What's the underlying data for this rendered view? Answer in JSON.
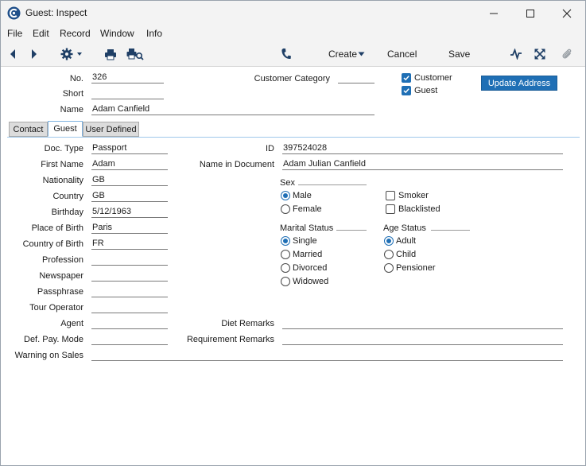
{
  "window": {
    "title": "Guest: Inspect"
  },
  "menu": {
    "items": [
      "File",
      "Edit",
      "Record",
      "Window",
      "Info"
    ]
  },
  "toolbar": {
    "create": "Create",
    "cancel": "Cancel",
    "save": "Save"
  },
  "header": {
    "no_label": "No.",
    "no_value": "326",
    "short_label": "Short",
    "short_value": "",
    "name_label": "Name",
    "name_value": "Adam Canfield",
    "customer_category_label": "Customer Category",
    "customer_category_value": "",
    "customer_label": "Customer",
    "customer_checked": true,
    "guest_label": "Guest",
    "guest_checked": true,
    "update_address": "Update Address"
  },
  "tabs": [
    "Contact",
    "Guest",
    "User Defined"
  ],
  "active_tab": "Guest",
  "guest": {
    "doc_type_label": "Doc. Type",
    "doc_type_value": "Passport",
    "first_name_label": "First Name",
    "first_name_value": "Adam",
    "nationality_label": "Nationality",
    "nationality_value": "GB",
    "country_label": "Country",
    "country_value": "GB",
    "birthday_label": "Birthday",
    "birthday_value": "5/12/1963",
    "place_of_birth_label": "Place of Birth",
    "place_of_birth_value": "Paris",
    "country_of_birth_label": "Country of Birth",
    "country_of_birth_value": "FR",
    "profession_label": "Profession",
    "profession_value": "",
    "newspaper_label": "Newspaper",
    "newspaper_value": "",
    "passphrase_label": "Passphrase",
    "passphrase_value": "",
    "tour_operator_label": "Tour Operator",
    "tour_operator_value": "",
    "agent_label": "Agent",
    "agent_value": "",
    "def_pay_mode_label": "Def. Pay. Mode",
    "def_pay_mode_value": "",
    "warning_on_sales_label": "Warning on Sales",
    "warning_on_sales_value": "",
    "id_label": "ID",
    "id_value": "397524028",
    "name_in_document_label": "Name in Document",
    "name_in_document_value": "Adam Julian Canfield",
    "diet_remarks_label": "Diet Remarks",
    "diet_remarks_value": "",
    "requirement_remarks_label": "Requirement Remarks",
    "requirement_remarks_value": "",
    "sex": {
      "title": "Sex",
      "options": [
        "Male",
        "Female"
      ],
      "selected": "Male"
    },
    "smoker": {
      "label": "Smoker",
      "checked": false
    },
    "blacklisted": {
      "label": "Blacklisted",
      "checked": false
    },
    "marital_status": {
      "title": "Marital Status",
      "options": [
        "Single",
        "Married",
        "Divorced",
        "Widowed"
      ],
      "selected": "Single"
    },
    "age_status": {
      "title": "Age Status",
      "options": [
        "Adult",
        "Child",
        "Pensioner"
      ],
      "selected": "Adult"
    }
  },
  "colors": {
    "accent": "#1f6fb5",
    "chrome": "#f3f3f3",
    "tab_inactive": "#dcdcdc"
  },
  "icons": [
    "app-icon",
    "minimize-icon",
    "maximize-icon",
    "close-icon",
    "back-arrow-icon",
    "forward-arrow-icon",
    "gear-icon",
    "print-icon",
    "print-preview-icon",
    "phone-icon",
    "activity-icon",
    "expand-icon",
    "attachment-icon"
  ]
}
